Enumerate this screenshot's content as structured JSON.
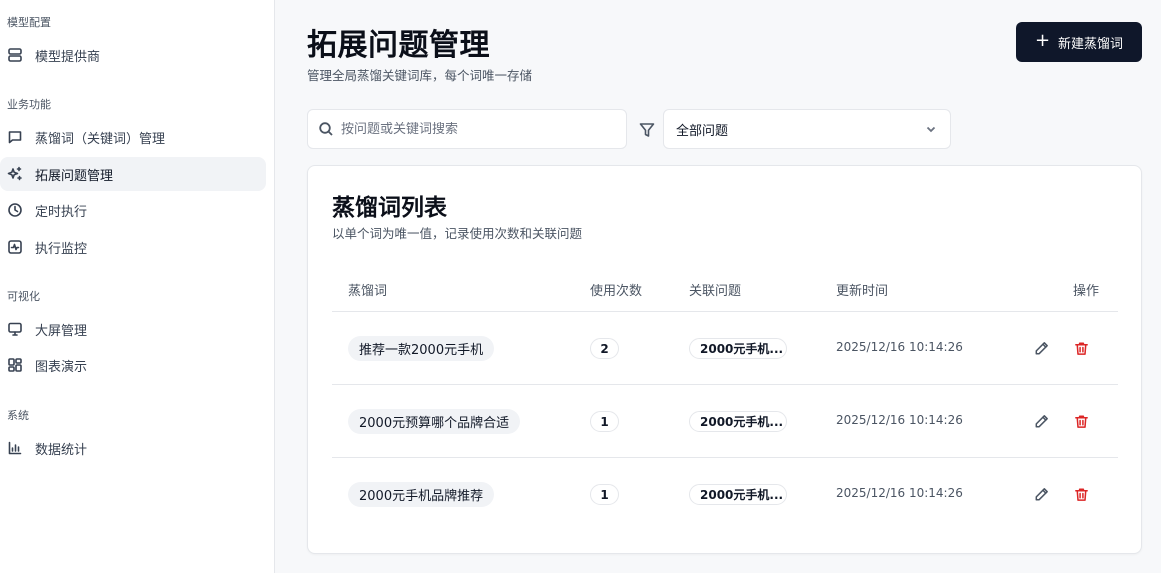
{
  "sidebar": {
    "groups": [
      {
        "title": "模型配置",
        "items": [
          {
            "label": "模型提供商",
            "icon": "server-icon"
          }
        ]
      },
      {
        "title": "业务功能",
        "items": [
          {
            "label": "蒸馏词（关键词）管理",
            "icon": "message-square-icon"
          },
          {
            "label": "拓展问题管理",
            "icon": "sparkles-icon",
            "active": true
          },
          {
            "label": "定时执行",
            "icon": "clock-icon"
          },
          {
            "label": "执行监控",
            "icon": "activity-icon"
          }
        ]
      },
      {
        "title": "可视化",
        "items": [
          {
            "label": "大屏管理",
            "icon": "monitor-icon"
          },
          {
            "label": "图表演示",
            "icon": "layout-grid-icon"
          }
        ]
      },
      {
        "title": "系统",
        "items": [
          {
            "label": "数据统计",
            "icon": "bar-chart-icon"
          }
        ]
      }
    ]
  },
  "header": {
    "title": "拓展问题管理",
    "subtitle": "管理全局蒸馏关键词库，每个词唯一存储",
    "new_button": "新建蒸馏词"
  },
  "filters": {
    "search_placeholder": "按问题或关键词搜索",
    "select_value": "全部问题"
  },
  "card": {
    "title": "蒸馏词列表",
    "subtitle": "以单个词为唯一值，记录使用次数和关联问题",
    "columns": [
      "蒸馏词",
      "使用次数",
      "关联问题",
      "更新时间",
      "操作"
    ],
    "rows": [
      {
        "keyword": "推荐一款2000元手机",
        "count": "2",
        "question": "2000元手机...",
        "updated": "2025/12/16 10:14:26"
      },
      {
        "keyword": "2000元预算哪个品牌合适",
        "count": "1",
        "question": "2000元手机...",
        "updated": "2025/12/16 10:14:26"
      },
      {
        "keyword": "2000元手机品牌推荐",
        "count": "1",
        "question": "2000元手机...",
        "updated": "2025/12/16 10:14:26"
      }
    ]
  },
  "colors": {
    "primary": "#0f172a",
    "danger": "#dc2626",
    "active_bg": "#f1f3f6"
  }
}
